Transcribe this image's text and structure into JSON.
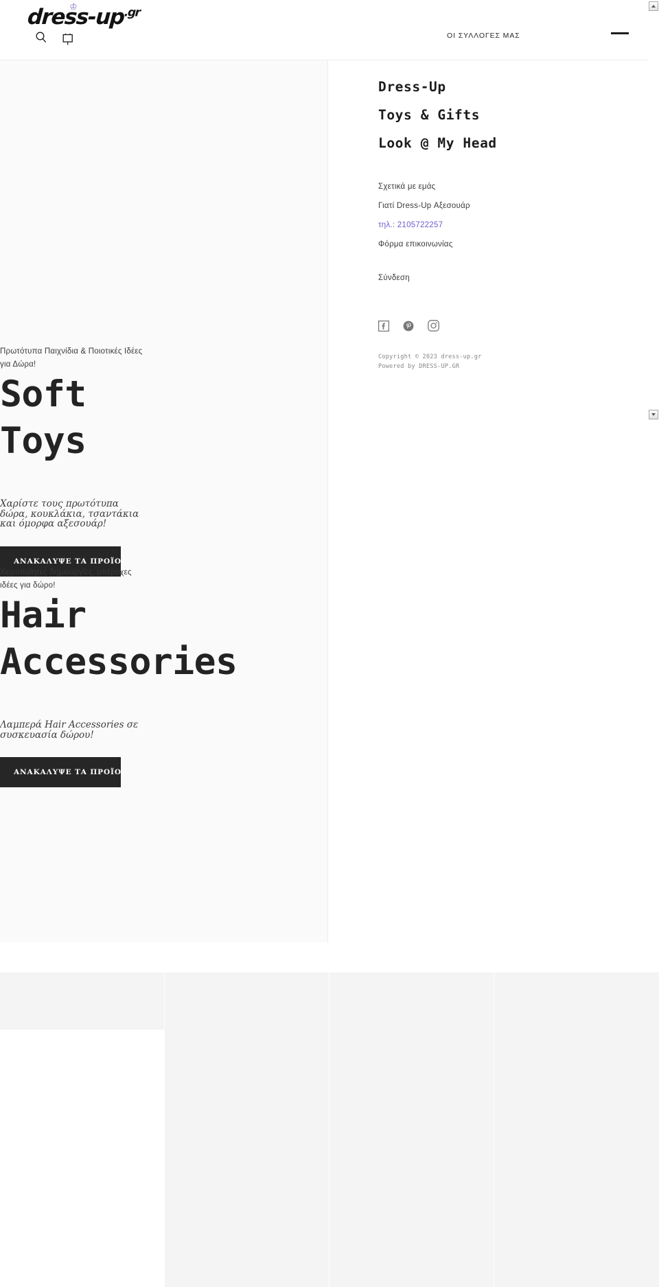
{
  "site": {
    "logo_text": "dress-up",
    "logo_tld": ".gr",
    "logo_crown_icon": "crown-icon",
    "search_icon": "search-icon",
    "cart_icon": "cart-icon"
  },
  "header": {
    "nav_collections": "ΟΙ ΣΥΛΛΟΓΕΣ ΜΑΣ",
    "menu_toggle_icon": "menu-icon"
  },
  "drawer": {
    "headings": [
      "Dress-Up",
      "Toys & Gifts",
      "Look @ My Head"
    ],
    "links": [
      {
        "label": "Σχετικά με εμάς",
        "type": "normal"
      },
      {
        "label": "Γιατί Dress-Up Αξεσουάρ",
        "type": "normal"
      },
      {
        "label": "τηλ.: 2105722257",
        "type": "phone"
      },
      {
        "label": "Φόρμα επικοινωνίας",
        "type": "normal"
      }
    ],
    "login_label": "Σύνδεση",
    "social": [
      {
        "name": "facebook-icon",
        "label": "Facebook"
      },
      {
        "name": "pinterest-icon",
        "label": "Pinterest"
      },
      {
        "name": "instagram-icon",
        "label": "Instagram"
      }
    ],
    "copyright_line1": "Copyright © 2023 dress-up.gr",
    "copyright_line2": "Powered by DRESS-UP.GR"
  },
  "promos": [
    {
      "eyebrow": "Πρωτότυπα Παιχνίδια & Ποιοτικές Ιδέες για Δώρα!",
      "title_line1": "Soft",
      "title_line2": "Toys",
      "subtitle": "Χαρίστε τους πρωτότυπα δώρα, κουκλάκια, τσαντάκια και όμορφα αξεσουάρ!",
      "button_label": "ΑΝΑΚΑΛΥΨΕ ΤΑ ΠΡΟΪΟΝΤΑ"
    },
    {
      "eyebrow": "Χειροποίητες δημιουργίες, υπέροχες ιδέες για δώρο!",
      "title_line1": "Hair",
      "title_line2": "Accessories",
      "subtitle": "Λαμπερά Hair Accessories σε συσκευασία δώρου!",
      "button_label": "ΑΝΑΚΑΛΥΨΕ ΤΑ ΠΡΟΪΟΝΤΑ"
    }
  ],
  "colors": {
    "accent_purple": "#6a5bd0",
    "button_dark": "#262626",
    "text_dark": "#232323",
    "placeholder_gray": "#f4f4f4"
  },
  "product_grid": {
    "columns": 4,
    "cells": [
      "",
      "",
      "",
      ""
    ]
  },
  "scrollbar": {
    "up_icon": "scroll-up-icon",
    "down_icon": "scroll-down-icon"
  }
}
